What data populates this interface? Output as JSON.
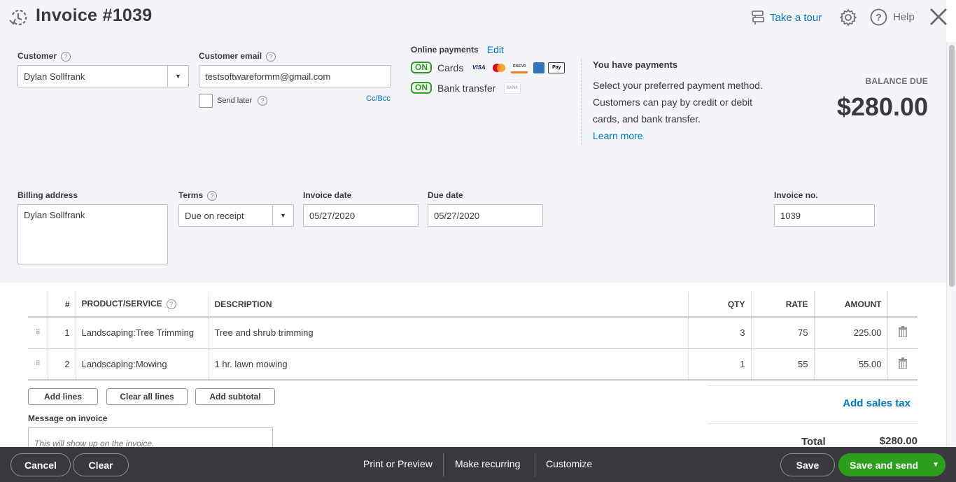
{
  "header": {
    "title": "Invoice #1039",
    "take_tour": "Take a tour",
    "help": "Help"
  },
  "customer": {
    "label": "Customer",
    "value": "Dylan Sollfrank"
  },
  "email": {
    "label": "Customer email",
    "value": "testsoftwareformm@gmail.com",
    "send_later": "Send later",
    "send_later_checked": false,
    "cc_bcc": "Cc/Bcc"
  },
  "online_payments": {
    "label": "Online payments",
    "edit": "Edit",
    "methods": [
      {
        "status": "ON",
        "name": "Cards",
        "logos": [
          "VISA",
          "MC",
          "DISCOVER",
          "AMEX",
          "Pay"
        ]
      },
      {
        "status": "ON",
        "name": "Bank transfer",
        "logos": [
          "BANK"
        ]
      }
    ]
  },
  "promo": {
    "title": "You have payments",
    "text": "Select your preferred payment method. Customers can pay by credit or debit cards, and bank transfer.",
    "learn_more": "Learn more"
  },
  "balance": {
    "label": "BALANCE DUE",
    "amount": "$280.00"
  },
  "billing": {
    "label": "Billing address",
    "value": "Dylan Sollfrank"
  },
  "terms": {
    "label": "Terms",
    "value": "Due on receipt"
  },
  "invoice_date": {
    "label": "Invoice date",
    "value": "05/27/2020"
  },
  "due_date": {
    "label": "Due date",
    "value": "05/27/2020"
  },
  "invoice_no": {
    "label": "Invoice no.",
    "value": "1039"
  },
  "table": {
    "headers": [
      "#",
      "PRODUCT/SERVICE",
      "DESCRIPTION",
      "QTY",
      "RATE",
      "AMOUNT"
    ],
    "rows": [
      {
        "num": "1",
        "product": "Landscaping:Tree Trimming",
        "description": "Tree and shrub trimming",
        "qty": "3",
        "rate": "75",
        "amount": "225.00"
      },
      {
        "num": "2",
        "product": "Landscaping:Mowing",
        "description": "1 hr. lawn mowing",
        "qty": "1",
        "rate": "55",
        "amount": "55.00"
      }
    ]
  },
  "line_actions": {
    "add_lines": "Add lines",
    "clear_all_lines": "Clear all lines",
    "add_subtotal": "Add subtotal"
  },
  "message": {
    "label": "Message on invoice",
    "placeholder": "This will show up on the invoice."
  },
  "totals": {
    "add_sales_tax": "Add sales tax",
    "total_label": "Total",
    "total_value": "$280.00"
  },
  "footer": {
    "cancel": "Cancel",
    "clear": "Clear",
    "print_preview": "Print or Preview",
    "make_recurring": "Make recurring",
    "customize": "Customize",
    "save": "Save",
    "save_and_send": "Save and send"
  },
  "colors": {
    "accent": "#0077c5",
    "success": "#2ca01c",
    "footer_bg": "#393a3d"
  }
}
